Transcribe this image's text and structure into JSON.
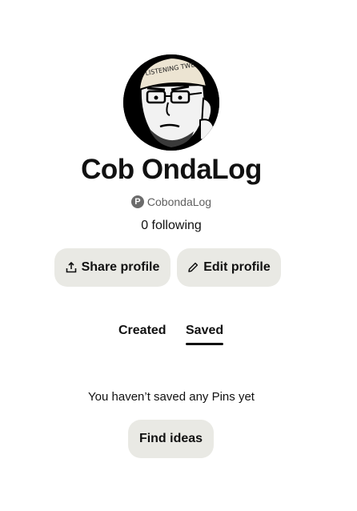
{
  "profile": {
    "name": "Cob OndaLog",
    "handle": "CobondaLog",
    "following": "0 following",
    "avatar_cap_text": "LISTENING TWE"
  },
  "actions": {
    "share_label": "Share profile",
    "edit_label": "Edit profile",
    "share_icon": "upload-icon",
    "edit_icon": "pencil-icon"
  },
  "tabs": [
    {
      "label": "Created",
      "active": false
    },
    {
      "label": "Saved",
      "active": true
    }
  ],
  "empty_state": {
    "message": "You haven’t saved any Pins yet",
    "button_label": "Find ideas"
  },
  "colors": {
    "button_bg": "#e9e9e4",
    "text": "#111111",
    "muted": "#5f5f5f"
  }
}
